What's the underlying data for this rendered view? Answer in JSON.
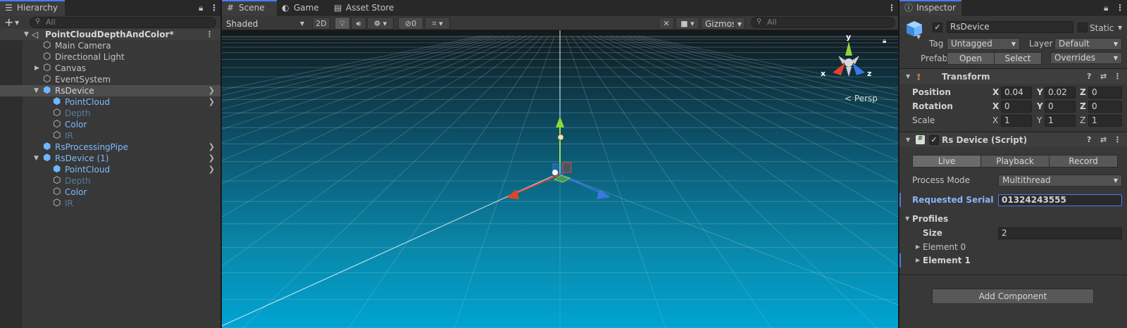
{
  "hierarchy": {
    "tab_label": "Hierarchy",
    "search_placeholder": "All",
    "add_label": "+",
    "items": [
      {
        "label": "PointCloudDepthAndColor*",
        "style": "scene"
      },
      {
        "label": "Main Camera",
        "style": "normal"
      },
      {
        "label": "Directional Light",
        "style": "normal"
      },
      {
        "label": "Canvas",
        "style": "normal"
      },
      {
        "label": "EventSystem",
        "style": "normal"
      },
      {
        "label": "RsDevice",
        "style": "prefab"
      },
      {
        "label": "PointCloud",
        "style": "prefab"
      },
      {
        "label": "Depth",
        "style": "dim"
      },
      {
        "label": "Color",
        "style": "normal"
      },
      {
        "label": "IR",
        "style": "dim"
      },
      {
        "label": "RsProcessingPipe",
        "style": "prefab"
      },
      {
        "label": "RsDevice (1)",
        "style": "prefab"
      },
      {
        "label": "PointCloud",
        "style": "prefab"
      },
      {
        "label": "Depth",
        "style": "dim"
      },
      {
        "label": "Color",
        "style": "normal"
      },
      {
        "label": "IR",
        "style": "dim"
      }
    ]
  },
  "scene": {
    "tabs": [
      {
        "label": "Scene",
        "icon": "scene-icon"
      },
      {
        "label": "Game",
        "icon": "game-icon"
      },
      {
        "label": "Asset Store",
        "icon": "asset-store-icon"
      }
    ],
    "shading_mode": "Shaded",
    "mode_2d": "2D",
    "hidden_count": "0",
    "gizmos_label": "Gizmos",
    "search_placeholder": "All",
    "persp_label": "Persp",
    "axis_labels": {
      "x": "x",
      "y": "y",
      "z": "z"
    }
  },
  "inspector": {
    "tab_label": "Inspector",
    "object_name": "RsDevice",
    "static_label": "Static",
    "tag_label": "Tag",
    "tag_value": "Untagged",
    "layer_label": "Layer",
    "layer_value": "Default",
    "prefab_label": "Prefab",
    "open_label": "Open",
    "select_label": "Select",
    "overrides_label": "Overrides",
    "transform": {
      "title": "Transform",
      "position_label": "Position",
      "rotation_label": "Rotation",
      "scale_label": "Scale",
      "position": {
        "x": "0.04",
        "y": "0.02",
        "z": "0"
      },
      "rotation": {
        "x": "0",
        "y": "0",
        "z": "0"
      },
      "scale": {
        "x": "1",
        "y": "1",
        "z": "1"
      }
    },
    "script": {
      "title": "Rs Device (Script)",
      "modes": [
        "Live",
        "Playback",
        "Record"
      ],
      "active_mode": "Live",
      "process_mode_label": "Process Mode",
      "process_mode_value": "Multithread",
      "serial_label": "Requested Serial",
      "serial_value": "01324243555",
      "profiles_label": "Profiles",
      "size_label": "Size",
      "size_value": "2",
      "element0_label": "Element 0",
      "element1_label": "Element 1"
    },
    "add_component_label": "Add Component"
  },
  "colors": {
    "accent": "#4a7cf0",
    "prefab_text": "#7ebaff",
    "sky_bottom": "#00a4d2",
    "axis_x": "#e0442c",
    "axis_y": "#8cd63a",
    "axis_z": "#3a78e6"
  }
}
